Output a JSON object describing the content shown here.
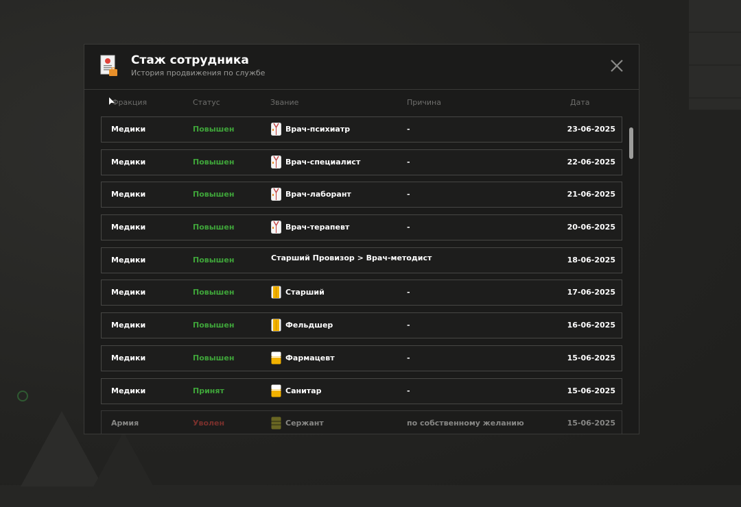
{
  "header": {
    "title": "Стаж сотрудника",
    "subtitle": "История продвижения по службе"
  },
  "columns": {
    "faction": "Фракция",
    "status": "Статус",
    "rank": "Звание",
    "reason": "Причина",
    "date": "Дата"
  },
  "rows": [
    {
      "faction": "Медики",
      "status": "Повышен",
      "rank": "Врач-психиатр",
      "rank_icon": "white-coat-icon",
      "reason": "-",
      "date": "23-06-2025"
    },
    {
      "faction": "Медики",
      "status": "Повышен",
      "rank": "Врач-специалист",
      "rank_icon": "white-coat-icon",
      "reason": "-",
      "date": "22-06-2025"
    },
    {
      "faction": "Медики",
      "status": "Повышен",
      "rank": "Врач-лаборант",
      "rank_icon": "white-coat-icon",
      "reason": "-",
      "date": "21-06-2025"
    },
    {
      "faction": "Медики",
      "status": "Повышен",
      "rank": "Врач-терапевт",
      "rank_icon": "white-coat-icon",
      "reason": "-",
      "date": "20-06-2025"
    },
    {
      "faction": "Медики",
      "status": "Повышен",
      "rank": "Старший Провизор > Врач-методист",
      "rank_icon": "",
      "reason": "",
      "date": "18-06-2025"
    },
    {
      "faction": "Медики",
      "status": "Повышен",
      "rank": "Старший",
      "rank_icon": "yellow-coat-icon",
      "reason": "-",
      "date": "17-06-2025"
    },
    {
      "faction": "Медики",
      "status": "Повышен",
      "rank": "Фельдшер",
      "rank_icon": "yellow-coat-icon",
      "reason": "-",
      "date": "16-06-2025"
    },
    {
      "faction": "Медики",
      "status": "Повышен",
      "rank": "Фармацевт",
      "rank_icon": "white-yellow-shirt-icon",
      "reason": "-",
      "date": "15-06-2025"
    },
    {
      "faction": "Медики",
      "status": "Принят",
      "rank": "Санитар",
      "rank_icon": "white-yellow-shirt-icon",
      "reason": "-",
      "date": "15-06-2025"
    },
    {
      "faction": "Армия",
      "status": "Уволен",
      "rank": "Сержант",
      "rank_icon": "army-uniform-icon",
      "reason": "по собственному желанию",
      "date": "15-06-2025"
    }
  ],
  "colors": {
    "promoted": "#3fa53a",
    "fired": "#a33a34",
    "accent_orange": "#e8902a"
  }
}
